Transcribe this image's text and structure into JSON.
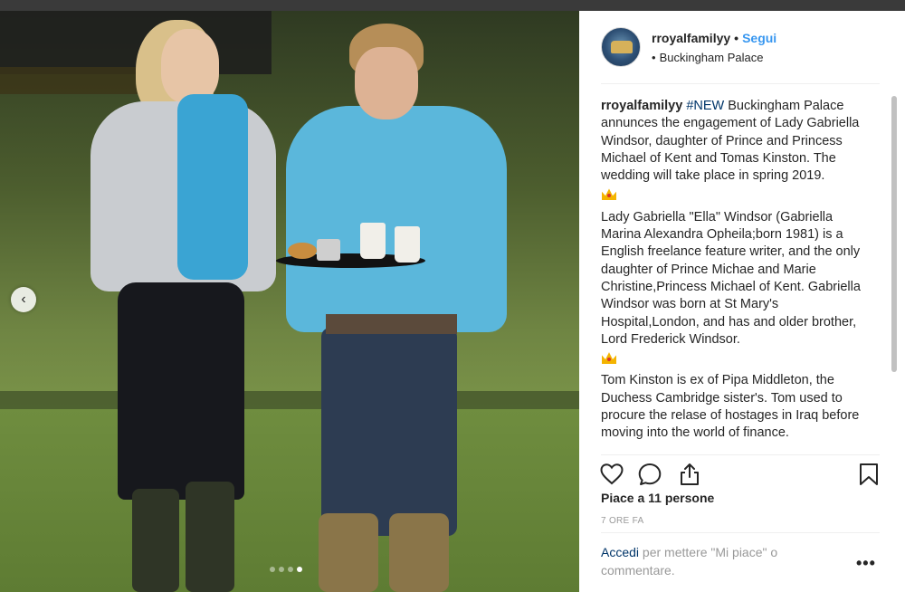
{
  "header": {
    "username": "rroyalfamilyy",
    "separator": "•",
    "follow_label": "Segui",
    "location_bullet": "•",
    "location": "Buckingham Palace"
  },
  "caption": {
    "username": "rroyalfamilyy",
    "hashtag": "#NEW",
    "p1": "Buckingham Palace annunces the engagement of Lady Gabriella Windsor, daughter of Prince and Princess Michael of Kent and Tomas Kinston. The wedding will take place in spring 2019.",
    "p2": "Lady Gabriella \"Ella\" Windsor (Gabriella Marina Alexandra Opheila;born 1981) is a English freelance feature writer, and the only daughter of Prince Michae and Marie Christine,Princess Michael of Kent. Gabriella Windsor was born at St Mary's Hospital,London, and has and older brother, Lord Frederick Windsor.",
    "p3": "Tom Kinston is ex of Pipa Middleton, the Duchess Cambridge sister's. Tom used to procure the relase of hostages in Iraq before moving into the world of finance.",
    "emoji": "crown-icon"
  },
  "carousel": {
    "prev_icon": "chevron-left-icon",
    "dot_count": 4,
    "active_dot": 4
  },
  "actions": {
    "like_icon": "heart-icon",
    "comment_icon": "comment-icon",
    "share_icon": "share-icon",
    "save_icon": "bookmark-icon"
  },
  "likes": "Piace a 11 persone",
  "time": "7 ORE FA",
  "login": {
    "link": "Accedi",
    "text": " per mettere \"Mi piace\" o commentare."
  },
  "more_label": "•••",
  "colors": {
    "link_blue": "#3897f0",
    "text": "#262626",
    "muted": "#999999",
    "hashtag": "#003569",
    "crown": "#f4b400"
  }
}
